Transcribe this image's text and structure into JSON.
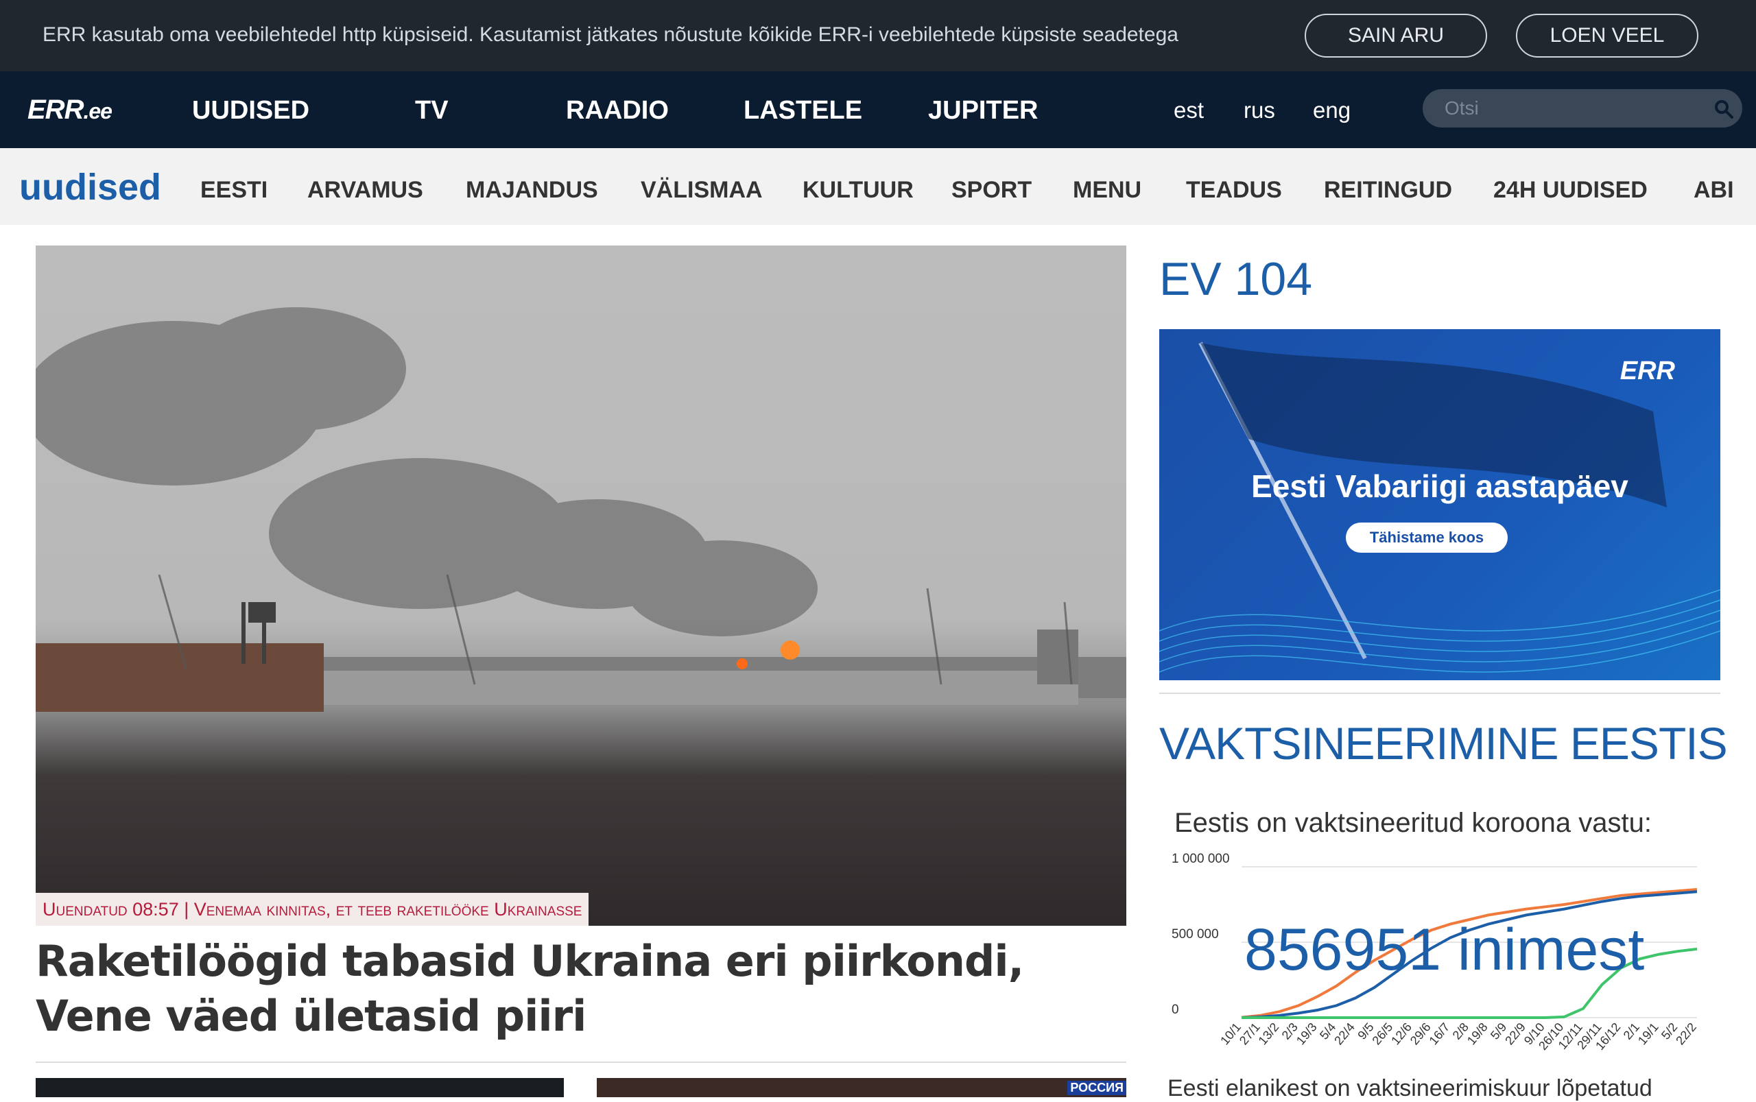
{
  "cookie": {
    "text": "ERR kasutab oma veebilehtedel http küpsiseid. Kasutamist jätkates nõustute kõikide ERR-i veebilehtede küpsiste seadetega",
    "accept_label": "SAIN ARU",
    "more_label": "LOEN VEEL"
  },
  "topnav": {
    "logo": "ERR",
    "logo_suffix": ".ee",
    "items": [
      "UUDISED",
      "TV",
      "RAADIO",
      "LASTELE",
      "JUPITER"
    ],
    "languages": [
      "est",
      "rus",
      "eng"
    ],
    "search_placeholder": "Otsi"
  },
  "subnav": {
    "brand": "uudised",
    "items": [
      "EESTI",
      "ARVAMUS",
      "MAJANDUS",
      "VÄLISMAA",
      "KULTUUR",
      "SPORT",
      "MENU",
      "TEADUS",
      "REITINGUD",
      "24H UUDISED",
      "ABI"
    ]
  },
  "main": {
    "hero_label": "Uuendatud 08:57 | Venemaa kinnitas, et teeb raketilööke Ukrainasse",
    "headline": "Raketilöögid tabasid Ukraina eri piirkondi, Vene väed ületasid piiri",
    "thumb2_tag": "РОССИЯ"
  },
  "sidebar": {
    "ev_title": "EV 104",
    "banner": {
      "logo": "ERR",
      "title": "Eesti Vabariigi aastapäev",
      "button": "Tähistame koos"
    },
    "vak_title": "VAKTSINEERIMINE EESTIS",
    "vak_subtitle": "Eestis on vaktsineeritud koroona vastu:",
    "bottom_text": "Eesti elanikest on vaktsineerimiskuur lõpetatud"
  },
  "colors": {
    "brand_blue": "#1c5fa8",
    "nav_dark": "#0b1c30",
    "cookie_bg": "#20272f",
    "label_red": "#b51b3a",
    "series_orange": "#f07a3c",
    "series_blue": "#1c5fa8",
    "series_green": "#3ec46a"
  },
  "chart_data": {
    "type": "line",
    "title": "Eestis on vaktsineeritud koroona vastu:",
    "overlay_value": "856951",
    "overlay_unit": "inimest",
    "y_ticks": [
      "1 000 000",
      "500 000",
      "0"
    ],
    "ylim": [
      0,
      1000000
    ],
    "categories": [
      "10/1",
      "27/1",
      "13/2",
      "2/3",
      "19/3",
      "5/4",
      "22/4",
      "9/5",
      "26/5",
      "12/6",
      "29/6",
      "16/7",
      "2/8",
      "19/8",
      "5/9",
      "22/9",
      "9/10",
      "26/10",
      "12/11",
      "29/11",
      "16/12",
      "2/1",
      "19/1",
      "5/2",
      "22/2"
    ],
    "series": [
      {
        "color": "#f07a3c",
        "values": [
          2000,
          15000,
          40000,
          80000,
          140000,
          210000,
          300000,
          380000,
          450000,
          520000,
          580000,
          620000,
          650000,
          680000,
          700000,
          720000,
          735000,
          750000,
          770000,
          790000,
          810000,
          820000,
          830000,
          840000,
          850000
        ]
      },
      {
        "color": "#1c5fa8",
        "values": [
          0,
          5000,
          15000,
          30000,
          50000,
          80000,
          130000,
          200000,
          290000,
          380000,
          460000,
          530000,
          580000,
          620000,
          650000,
          680000,
          700000,
          720000,
          745000,
          770000,
          790000,
          805000,
          815000,
          825000,
          835000
        ]
      },
      {
        "color": "#3ec46a",
        "values": [
          0,
          0,
          0,
          0,
          0,
          0,
          0,
          0,
          0,
          0,
          0,
          0,
          0,
          0,
          0,
          0,
          0,
          5000,
          60000,
          220000,
          330000,
          390000,
          420000,
          440000,
          455000
        ]
      }
    ]
  }
}
